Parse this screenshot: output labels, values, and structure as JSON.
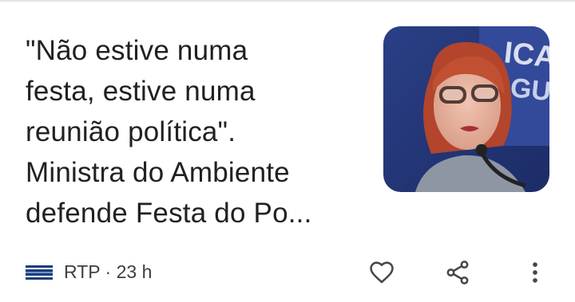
{
  "article": {
    "headline": "\"Não estive numa festa, estive numa reunião política\". Ministra do Ambiente defende Festa do Po...",
    "headline_lines": [
      "\"Não estive numa",
      "festa, estive numa",
      "reunião política\".",
      "Ministra do Ambiente",
      "defende Festa do Po..."
    ],
    "thumbnail": {
      "backdrop_letters_top": "ICA",
      "backdrop_letters_bottom": "GUI",
      "icon": "news-photo-woman-speaking"
    },
    "source": {
      "logo_icon": "rtp-logo-icon",
      "text": "RTP · 23 h"
    }
  },
  "actions": {
    "like_icon": "heart-icon",
    "share_icon": "share-icon",
    "more_icon": "more-vert-icon"
  },
  "colors": {
    "text_primary": "#202124",
    "text_secondary": "#3c4043",
    "icon": "#444746",
    "rtp_blue": "#1b3d7a"
  }
}
